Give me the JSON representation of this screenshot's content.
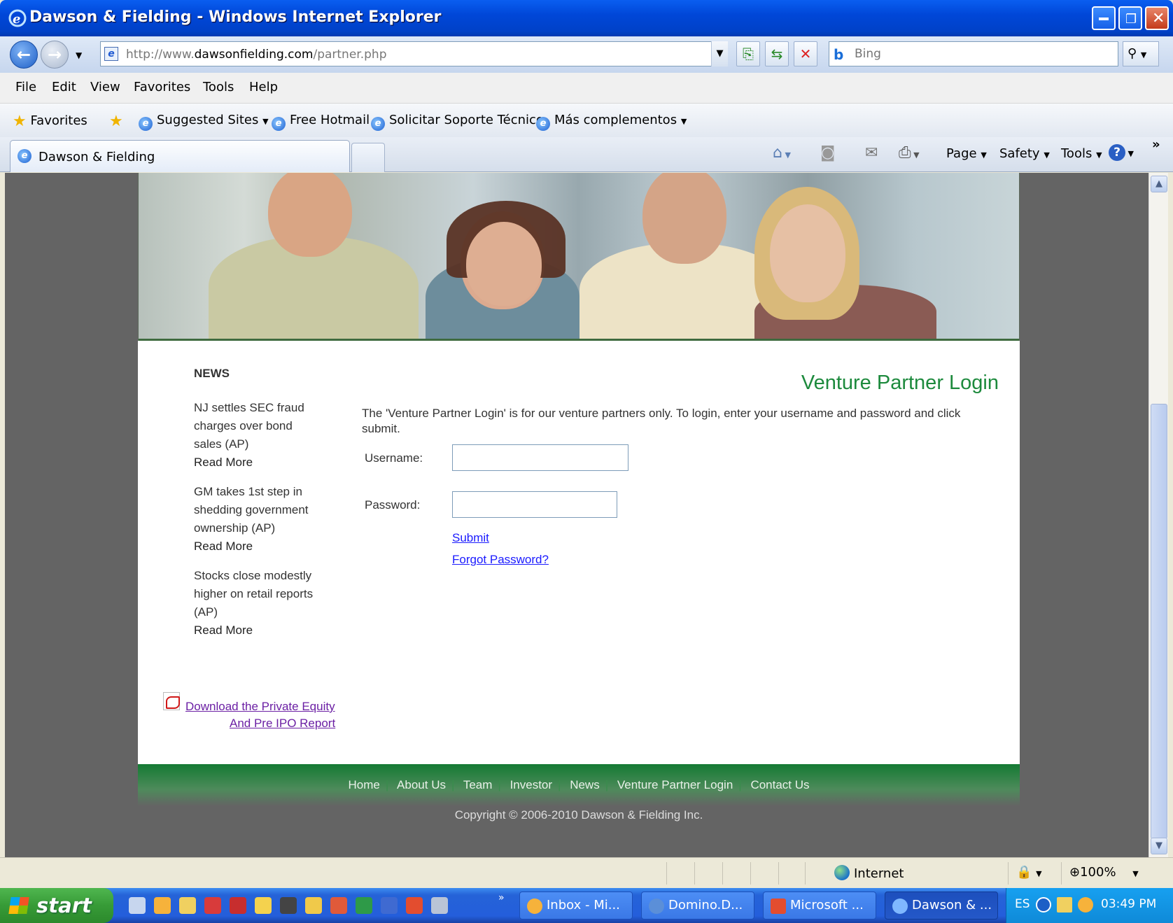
{
  "window": {
    "title": "Dawson & Fielding - Windows Internet Explorer"
  },
  "address": {
    "url_prefix": "http://www.",
    "url_domain": "dawsonfielding.com",
    "url_path": "/partner.php",
    "search_placeholder": "Bing"
  },
  "menu": [
    "File",
    "Edit",
    "View",
    "Favorites",
    "Tools",
    "Help"
  ],
  "favorites_bar": {
    "favorites_label": "Favorites",
    "items": [
      "Suggested Sites",
      "Free Hotmail",
      "Solicitar Soporte Técnico",
      "Más complementos"
    ]
  },
  "tabs": [
    {
      "label": "Dawson & Fielding"
    }
  ],
  "command_bar": {
    "page": "Page",
    "safety": "Safety",
    "tools": "Tools",
    "more": "»"
  },
  "sidebar": {
    "heading": "NEWS",
    "news": [
      {
        "line1": "NJ settles SEC fraud",
        "line2": "charges over bond",
        "line3": "sales (AP)",
        "more": "Read More"
      },
      {
        "line1": "GM takes 1st step in",
        "line2": "shedding government",
        "line3": "ownership (AP)",
        "more": "Read More"
      },
      {
        "line1": "Stocks close modestly",
        "line2": "higher on retail reports",
        "line3": "(AP)",
        "more": "Read More"
      }
    ],
    "download_line1": "Download the Private Equity",
    "download_line2": "And Pre IPO Report"
  },
  "login": {
    "title": "Venture Partner Login",
    "intro": "The 'Venture Partner Login' is for our venture partners only. To login, enter your username and password and click submit.",
    "username_label": "Username:",
    "password_label": "Password:",
    "submit": "Submit",
    "forgot": "Forgot Password?"
  },
  "footer": {
    "nav": [
      "Home",
      "About Us",
      "Team",
      "Investor",
      "News",
      "Venture Partner Login",
      "Contact Us"
    ],
    "copyright": "Copyright © 2006-2010 Dawson & Fielding Inc."
  },
  "statusbar": {
    "zone": "Internet",
    "zoom": "100%"
  },
  "taskbar": {
    "start": "start",
    "tasks": [
      "Inbox - Mi...",
      "Domino.D...",
      "Microsoft ...",
      "Dawson & ..."
    ],
    "lang": "ES",
    "clock": "03:49 PM"
  },
  "colors": {
    "accent_green": "#1d8a3d",
    "link_blue": "#1a1aff",
    "visited_purple": "#6b1fa4",
    "footer_green": "#147a33"
  }
}
